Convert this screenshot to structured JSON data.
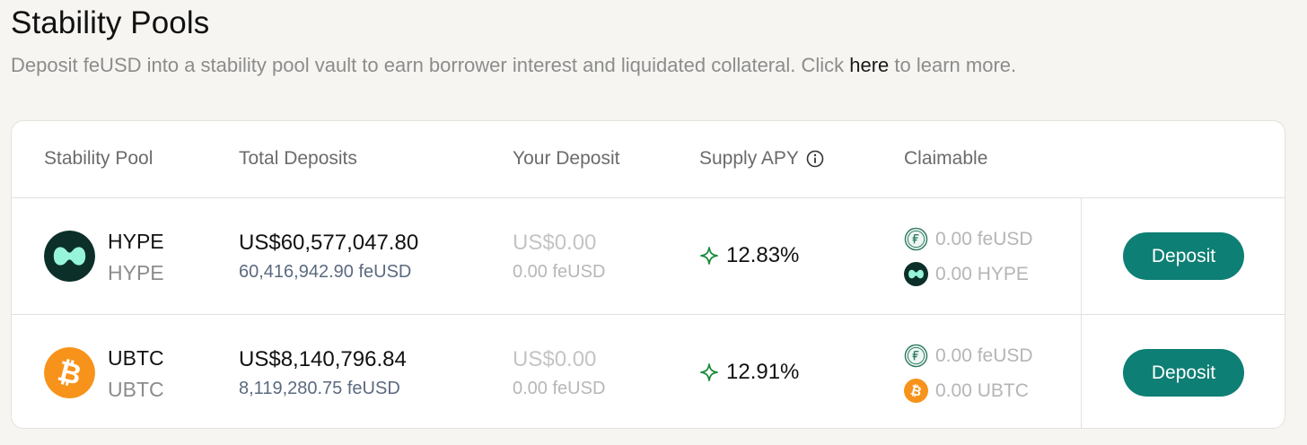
{
  "page": {
    "title": "Stability Pools",
    "subtitle_before": "Deposit feUSD into a stability pool vault to earn borrower interest and liquidated collateral. Click ",
    "subtitle_link": "here",
    "subtitle_after": " to learn more."
  },
  "table": {
    "headers": {
      "pool": "Stability Pool",
      "total": "Total Deposits",
      "your": "Your Deposit",
      "apy": "Supply APY",
      "claimable": "Claimable"
    },
    "rows": [
      {
        "asset": "HYPE",
        "asset_sub": "HYPE",
        "asset_icon": "hype-logo-icon",
        "total_usd": "US$60,577,047.80",
        "total_token": "60,416,942.90 feUSD",
        "your_usd": "US$0.00",
        "your_token": "0.00 feUSD",
        "apy": "12.83%",
        "claim_1": "0.00 feUSD",
        "claim_2": "0.00 HYPE",
        "button": "Deposit"
      },
      {
        "asset": "UBTC",
        "asset_sub": "UBTC",
        "asset_icon": "bitcoin-logo-icon",
        "total_usd": "US$8,140,796.84",
        "total_token": "8,119,280.75 feUSD",
        "your_usd": "US$0.00",
        "your_token": "0.00 feUSD",
        "apy": "12.91%",
        "claim_1": "0.00 feUSD",
        "claim_2": "0.00 UBTC",
        "button": "Deposit"
      }
    ]
  },
  "colors": {
    "accent": "#0e7f74",
    "apy_icon": "#1a8a3a",
    "hype": "#0c2f29",
    "hype_mark": "#96f4da",
    "bitcoin": "#f7931a",
    "background": "#f6f5f1"
  }
}
